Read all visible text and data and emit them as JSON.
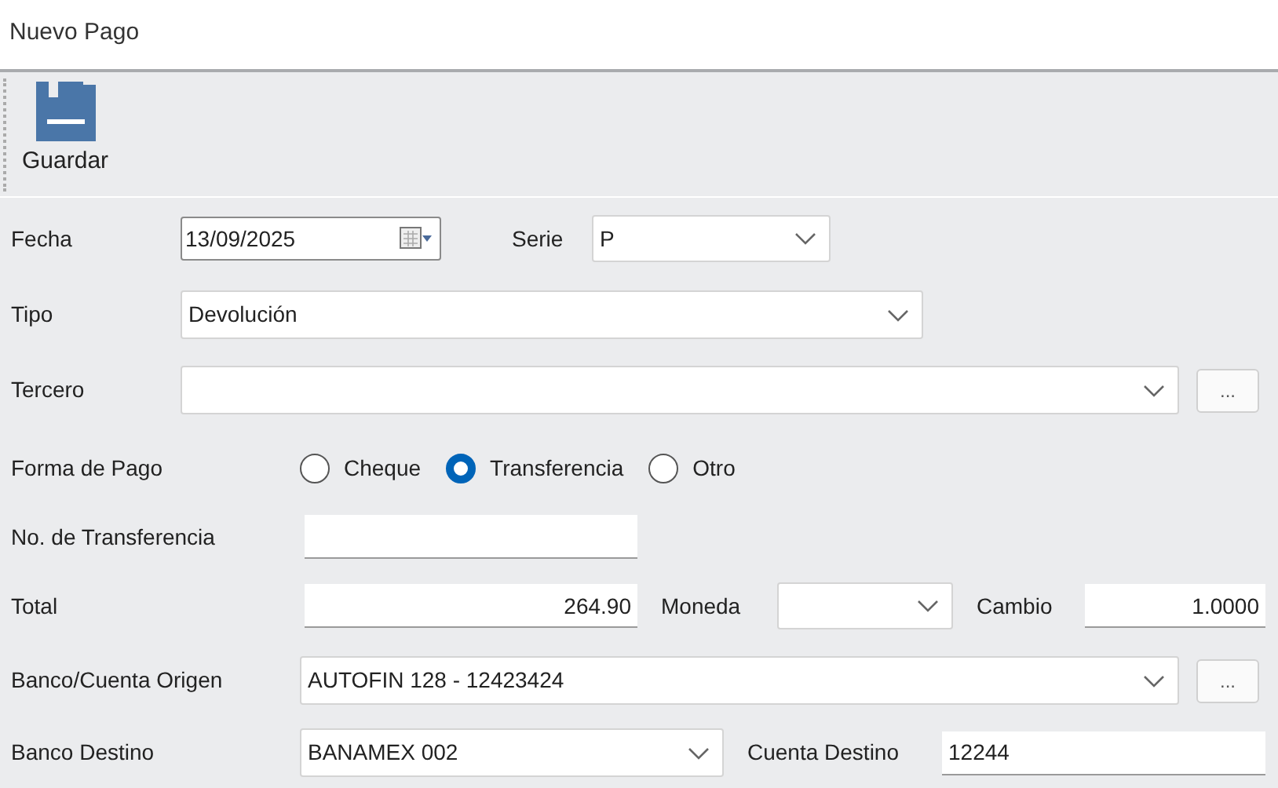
{
  "window": {
    "title": "Nuevo Pago"
  },
  "toolbar": {
    "save_label": "Guardar"
  },
  "fecha": {
    "label": "Fecha",
    "value": "13/09/2025"
  },
  "serie": {
    "label": "Serie",
    "value": "P"
  },
  "tipo": {
    "label": "Tipo",
    "value": "Devolución"
  },
  "tercero": {
    "label": "Tercero",
    "browse": "..."
  },
  "forma_de_pago": {
    "label": "Forma de Pago",
    "options": [
      {
        "label": "Cheque",
        "selected": false
      },
      {
        "label": "Transferencia",
        "selected": true
      },
      {
        "label": "Otro",
        "selected": false
      }
    ]
  },
  "no_transferencia": {
    "label": "No. de Transferencia"
  },
  "total": {
    "label": "Total",
    "value": "264.90"
  },
  "moneda": {
    "label": "Moneda"
  },
  "cambio": {
    "label": "Cambio",
    "value": "1.0000"
  },
  "banco_origen": {
    "label": "Banco/Cuenta Origen",
    "value": "AUTOFIN 128 - 12423424",
    "browse": "..."
  },
  "banco_destino": {
    "label": "Banco Destino",
    "value": "BANAMEX 002"
  },
  "cuenta_destino": {
    "label": "Cuenta Destino",
    "value": "12244"
  }
}
